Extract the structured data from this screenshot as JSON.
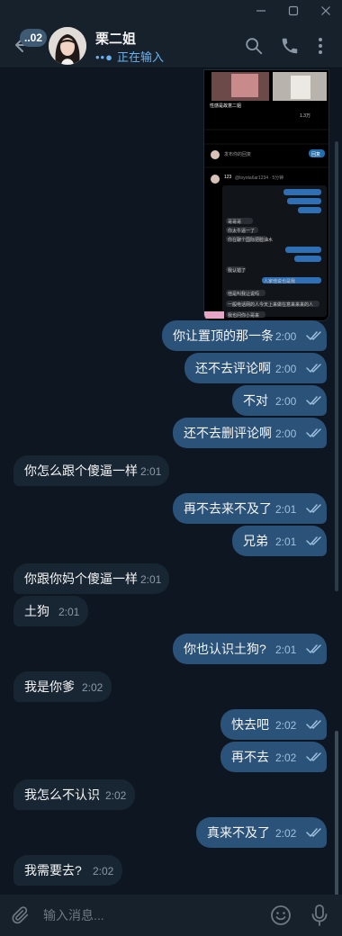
{
  "window": {
    "controls": [
      "minimize",
      "maximize",
      "close"
    ]
  },
  "header": {
    "unread_count": "..02",
    "name": "栗二姐",
    "status_dots": "••●",
    "status": "正在输入",
    "icons": [
      "back-arrow-icon",
      "search-icon",
      "phone-icon",
      "more-vertical-icon"
    ]
  },
  "media": {
    "quoted_title": "性感是故意二姐",
    "reply_placeholder": "发布你的回复",
    "reply_button": "回复",
    "stats": "1.3万",
    "reply_user": "123",
    "reply_handle": "@toyota6ar1234 · 5分钟",
    "lines": [
      "哥哥哥",
      "你太牛逼一了",
      "你在聊个国际把脸油水",
      "我认错了",
      "人家他说也是我",
      "他是叫我让说吗",
      "一般电话网的人今天上来做在意来来来的人",
      "我也问你小哥来"
    ]
  },
  "messages": [
    {
      "dir": "out",
      "text": "你让置顶的那一条",
      "time": "2:00"
    },
    {
      "dir": "out",
      "text": "还不去评论啊",
      "time": "2:00"
    },
    {
      "dir": "out",
      "text": "不对",
      "time": "2:00"
    },
    {
      "dir": "out",
      "text": "还不去删评论啊",
      "time": "2:00"
    },
    {
      "dir": "in",
      "text": "你怎么跟个傻逼一样",
      "time": "2:01"
    },
    {
      "dir": "out",
      "text": "再不去来不及了",
      "time": "2:01"
    },
    {
      "dir": "out",
      "text": "兄弟",
      "time": "2:01"
    },
    {
      "dir": "in",
      "text": "你跟你妈个傻逼一样",
      "time": "2:01"
    },
    {
      "dir": "in",
      "text": "土狗",
      "time": "2:01"
    },
    {
      "dir": "out",
      "text": "你也认识土狗?",
      "time": "2:01"
    },
    {
      "dir": "in",
      "text": "我是你爹",
      "time": "2:02"
    },
    {
      "dir": "out",
      "text": "快去吧",
      "time": "2:02"
    },
    {
      "dir": "out",
      "text": "再不去",
      "time": "2:02"
    },
    {
      "dir": "in",
      "text": "我怎么不认识",
      "time": "2:02"
    },
    {
      "dir": "out",
      "text": "真来不及了",
      "time": "2:02"
    },
    {
      "dir": "in",
      "text": "我需要去?",
      "time": "2:02"
    }
  ],
  "input": {
    "placeholder": "输入消息..."
  },
  "colors": {
    "background": "#0e1621",
    "header": "#17212b",
    "outgoing_bubble": "#2b5278",
    "incoming_bubble": "#182533",
    "accent": "#6ab2f2"
  }
}
